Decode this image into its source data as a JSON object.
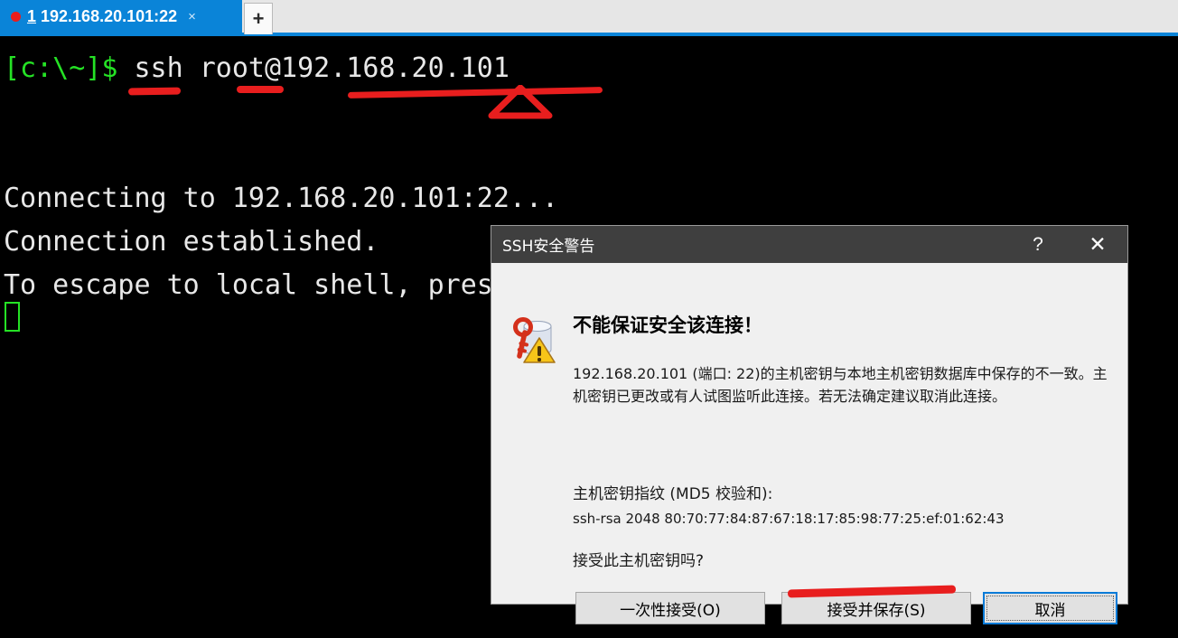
{
  "tabbar": {
    "active_tab": {
      "index": "1",
      "title": "192.168.20.101:22",
      "close_label": "×",
      "status_dot_color": "#ea1c1c"
    },
    "new_tab_label": "+"
  },
  "terminal": {
    "prompt": "[c:\\~]$ ",
    "command": "ssh root@192.168.20.101",
    "line_connecting": "Connecting to 192.168.20.101:22...",
    "line_established": "Connection established.",
    "line_escape": "To escape to local shell, press 'Ctrl+Alt+]'.",
    "background_color": "#000000",
    "prompt_color": "#25e225",
    "text_color": "#e8e8e8",
    "cursor_color": "#25e225"
  },
  "annotations": {
    "color": "#e81e1e",
    "marks": [
      "underline-ssh",
      "underline-root",
      "underline-ip-address",
      "triangle-pointer-ip",
      "underline-accept-and-save-button"
    ]
  },
  "dialog": {
    "title": "SSH安全警告",
    "help_label": "?",
    "close_label": "✕",
    "icon": "key-warning-icon",
    "heading": "不能保证安全该连接！",
    "body_text": "192.168.20.101 (端口: 22)的主机密钥与本地主机密钥数据库中保存的不一致。主机密钥已更改或有人试图监听此连接。若无法确定建议取消此连接。",
    "fingerprint_label": "主机密钥指纹 (MD5 校验和):",
    "fingerprint_value": "ssh-rsa 2048 80:70:77:84:87:67:18:17:85:98:77:25:ef:01:62:43",
    "question": "接受此主机密钥吗?",
    "buttons": {
      "accept_once": "一次性接受(O)",
      "accept_and_save": "接受并保存(S)",
      "cancel": "取消"
    },
    "focused_button": "cancel",
    "title_bar_color": "#3f3f3f",
    "body_color": "#f0f0f0",
    "focus_border_color": "#0a7bd8"
  }
}
